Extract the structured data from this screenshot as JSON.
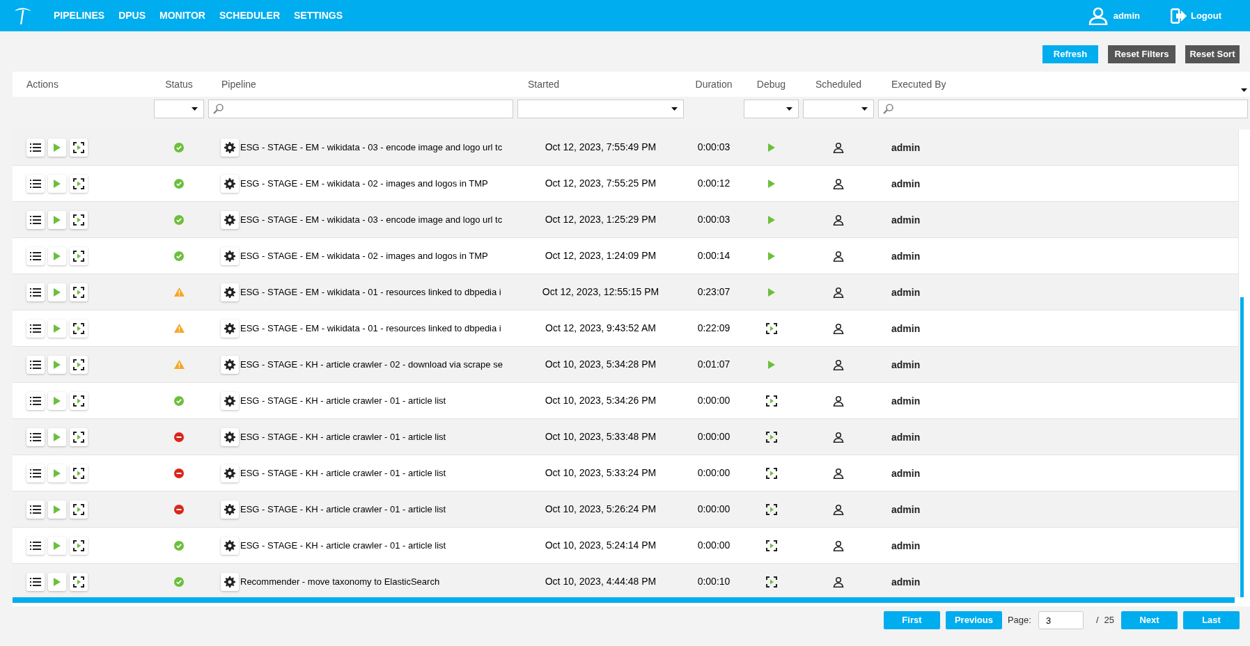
{
  "nav": {
    "items": [
      "PIPELINES",
      "DPUS",
      "MONITOR",
      "SCHEDULER",
      "SETTINGS"
    ],
    "user": "admin",
    "logout": "Logout"
  },
  "toolbar": {
    "buttons": [
      {
        "label": "Refresh",
        "kind": "primary"
      },
      {
        "label": "Reset Filters",
        "kind": "secondary"
      },
      {
        "label": "Reset Sort",
        "kind": "secondary"
      }
    ]
  },
  "table": {
    "columns": [
      {
        "label": "Actions"
      },
      {
        "label": "Status",
        "filter": {
          "kind": "select"
        }
      },
      {
        "label": "Pipeline",
        "filter": {
          "kind": "search"
        }
      },
      {
        "label": "Started",
        "filter": {
          "kind": "select"
        }
      },
      {
        "label": "Duration"
      },
      {
        "label": "Debug",
        "filter": {
          "kind": "select"
        }
      },
      {
        "label": "Scheduled",
        "filter": {
          "kind": "select"
        }
      },
      {
        "label": "Executed By",
        "filter": {
          "kind": "search"
        }
      }
    ],
    "rows": [
      {
        "status": {
          "kind": "success"
        },
        "pipeline": "ESG - STAGE - EM - wikidata - 03 - encode image and logo url tc",
        "started": "Oct 12, 2023, 7:55:49 PM",
        "duration": "0:00:03",
        "debug": {
          "kind": "run"
        },
        "executed_by": "admin"
      },
      {
        "status": {
          "kind": "success"
        },
        "pipeline": "ESG - STAGE - EM - wikidata - 02 - images and logos in TMP",
        "started": "Oct 12, 2023, 7:55:25 PM",
        "duration": "0:00:12",
        "debug": {
          "kind": "run"
        },
        "executed_by": "admin"
      },
      {
        "status": {
          "kind": "success"
        },
        "pipeline": "ESG - STAGE - EM - wikidata - 03 - encode image and logo url tc",
        "started": "Oct 12, 2023, 1:25:29 PM",
        "duration": "0:00:03",
        "debug": {
          "kind": "run"
        },
        "executed_by": "admin"
      },
      {
        "status": {
          "kind": "success"
        },
        "pipeline": "ESG - STAGE - EM - wikidata - 02 - images and logos in TMP",
        "started": "Oct 12, 2023, 1:24:09 PM",
        "duration": "0:00:14",
        "debug": {
          "kind": "run"
        },
        "executed_by": "admin"
      },
      {
        "status": {
          "kind": "warning"
        },
        "pipeline": "ESG - STAGE - EM - wikidata - 01 - resources linked to dbpedia i",
        "started": "Oct 12, 2023, 12:55:15 PM",
        "duration": "0:23:07",
        "debug": {
          "kind": "run"
        },
        "executed_by": "admin"
      },
      {
        "status": {
          "kind": "warning"
        },
        "pipeline": "ESG - STAGE - EM - wikidata - 01 - resources linked to dbpedia i",
        "started": "Oct 12, 2023, 9:43:52 AM",
        "duration": "0:22:09",
        "debug": {
          "kind": "debug"
        },
        "executed_by": "admin"
      },
      {
        "status": {
          "kind": "warning"
        },
        "pipeline": "ESG - STAGE - KH - article crawler - 02 - download via scrape se",
        "started": "Oct 10, 2023, 5:34:28 PM",
        "duration": "0:01:07",
        "debug": {
          "kind": "run"
        },
        "executed_by": "admin"
      },
      {
        "status": {
          "kind": "success"
        },
        "pipeline": "ESG - STAGE - KH - article crawler - 01 - article list",
        "started": "Oct 10, 2023, 5:34:26 PM",
        "duration": "0:00:00",
        "debug": {
          "kind": "debug"
        },
        "executed_by": "admin"
      },
      {
        "status": {
          "kind": "error"
        },
        "pipeline": "ESG - STAGE - KH - article crawler - 01 - article list",
        "started": "Oct 10, 2023, 5:33:48 PM",
        "duration": "0:00:00",
        "debug": {
          "kind": "debug"
        },
        "executed_by": "admin"
      },
      {
        "status": {
          "kind": "error"
        },
        "pipeline": "ESG - STAGE - KH - article crawler - 01 - article list",
        "started": "Oct 10, 2023, 5:33:24 PM",
        "duration": "0:00:00",
        "debug": {
          "kind": "debug"
        },
        "executed_by": "admin"
      },
      {
        "status": {
          "kind": "error"
        },
        "pipeline": "ESG - STAGE - KH - article crawler - 01 - article list",
        "started": "Oct 10, 2023, 5:26:24 PM",
        "duration": "0:00:00",
        "debug": {
          "kind": "debug"
        },
        "executed_by": "admin"
      },
      {
        "status": {
          "kind": "success"
        },
        "pipeline": "ESG - STAGE - KH - article crawler - 01 - article list",
        "started": "Oct 10, 2023, 5:24:14 PM",
        "duration": "0:00:00",
        "debug": {
          "kind": "debug"
        },
        "executed_by": "admin"
      },
      {
        "status": {
          "kind": "success"
        },
        "pipeline": "Recommender - move taxonomy to ElasticSearch",
        "started": "Oct 10, 2023, 4:44:48 PM",
        "duration": "0:00:10",
        "debug": {
          "kind": "debug"
        },
        "executed_by": "admin"
      }
    ]
  },
  "pagination": {
    "first": "First",
    "previous": "Previous",
    "page_label": "Page:",
    "page": "3",
    "separator": "/",
    "total": "25",
    "next": "Next",
    "last": "Last"
  }
}
